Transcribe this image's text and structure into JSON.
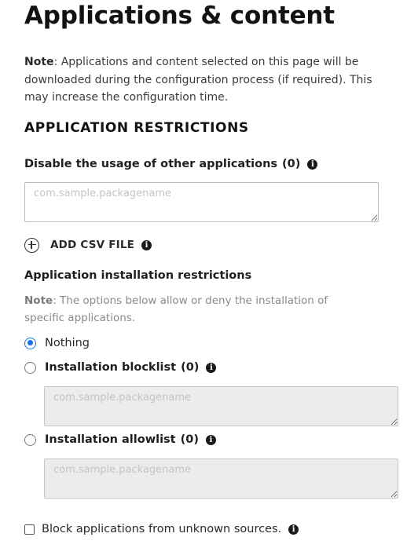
{
  "page": {
    "title": "Applications & content",
    "note_prefix": "Note",
    "note_text": ": Applications and content selected on this page will be downloaded during the configuration process (if required). This may increase the configuration time."
  },
  "app_restrictions": {
    "section_title": "APPLICATION RESTRICTIONS",
    "disable_other_apps": {
      "label": "Disable the usage of other applications",
      "count": "(0)",
      "placeholder": "com.sample.packagename"
    },
    "add_csv_label": "ADD CSV FILE",
    "install_restrictions": {
      "heading": "Application installation restrictions",
      "note_prefix": "Note",
      "note_text": ": The options below allow or deny the installation of specific applications.",
      "options": [
        {
          "label": "Nothing",
          "selected": true
        },
        {
          "label": "Installation blocklist",
          "count": "(0)",
          "selected": false,
          "placeholder": "com.sample.packagename"
        },
        {
          "label": "Installation allowlist",
          "count": "(0)",
          "selected": false,
          "placeholder": "com.sample.packagename"
        }
      ]
    },
    "block_unknown_sources": {
      "label": "Block applications from unknown sources.",
      "checked": false
    }
  },
  "icons": {
    "info": "info-icon",
    "add": "plus-circle-icon"
  },
  "colors": {
    "accent": "#1a73e8",
    "text": "#1f1f1f",
    "muted": "#8a8a8a",
    "disabled_field": "#ececec"
  }
}
